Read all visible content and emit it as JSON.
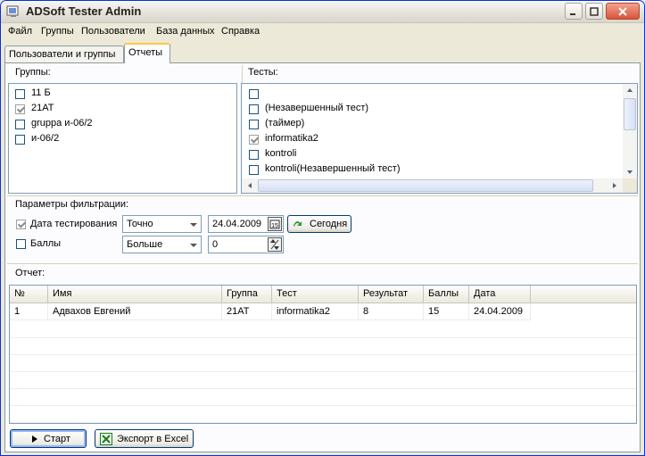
{
  "window": {
    "title": "ADSoft Tester Admin"
  },
  "menu": [
    "Файл",
    "Группы",
    "Пользователи",
    "База данных",
    "Справка"
  ],
  "tabs": [
    {
      "label": "Пользователи и группы",
      "active": false
    },
    {
      "label": "Отчеты",
      "active": true
    }
  ],
  "groups": {
    "title": "Группы:",
    "items": [
      {
        "label": "11 Б",
        "checked": false
      },
      {
        "label": "21АТ",
        "checked": true
      },
      {
        "label": "gruppa и-06/2",
        "checked": false
      },
      {
        "label": "и-06/2",
        "checked": false
      }
    ]
  },
  "tests": {
    "title": "Тесты:",
    "items": [
      {
        "label": "",
        "checked": false
      },
      {
        "label": "(Незавершенный тест)",
        "checked": false
      },
      {
        "label": "(таймер)",
        "checked": false
      },
      {
        "label": "informatika2",
        "checked": true
      },
      {
        "label": "kontroli",
        "checked": false
      },
      {
        "label": "kontroli(Незавершенный тест)",
        "checked": false
      }
    ]
  },
  "filter": {
    "title": "Параметры фильтрации:",
    "date": {
      "label": "Дата тестирования",
      "checked": true,
      "mode": "Точно",
      "value": "24.04.2009",
      "today_label": "Сегодня"
    },
    "score": {
      "label": "Баллы",
      "checked": false,
      "mode": "Больше",
      "value": "0"
    }
  },
  "report": {
    "title": "Отчет:",
    "columns": [
      "№",
      "Имя",
      "Группа",
      "Тест",
      "Результат",
      "Баллы",
      "Дата"
    ],
    "rows": [
      [
        "1",
        "Адвахов Евгений",
        "21АТ",
        "informatika2",
        "8",
        "15",
        "24.04.2009"
      ]
    ]
  },
  "buttons": {
    "start": "Старт",
    "export": "Экспорт в Excel"
  },
  "colors": {
    "accent": "#0831d9",
    "check": "#21a121",
    "border": "#7f9db9"
  }
}
